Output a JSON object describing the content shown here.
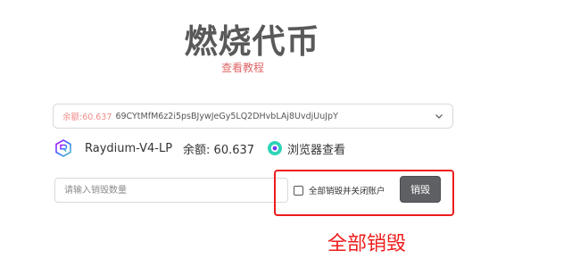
{
  "page": {
    "title": "燃烧代币",
    "tutorial_link": "查看教程"
  },
  "token_select": {
    "balance_label": "余额:",
    "balance_value": "60.637",
    "address": "69CYtMfM6z2i5psBJywJeGy5LQ2DHvbLAj8UvdjUuJpY",
    "icon": "chevron-down-icon"
  },
  "token_info": {
    "icon": "raydium-logo-icon",
    "name": "Raydium-V4-LP",
    "balance_text": "余额: 60.637",
    "explorer_icon": "explorer-icon",
    "explorer_label": "浏览器查看"
  },
  "burn_form": {
    "amount_placeholder": "请输入销毁数量",
    "close_account_label": "全部销毁并关闭账户",
    "close_account_checked": false,
    "burn_button": "销毁"
  },
  "annotation": {
    "label": "全部销毁",
    "color": "#ee1c1c"
  },
  "colors": {
    "link": "#e06666",
    "button_bg": "#5e6063",
    "title": "#595959"
  }
}
